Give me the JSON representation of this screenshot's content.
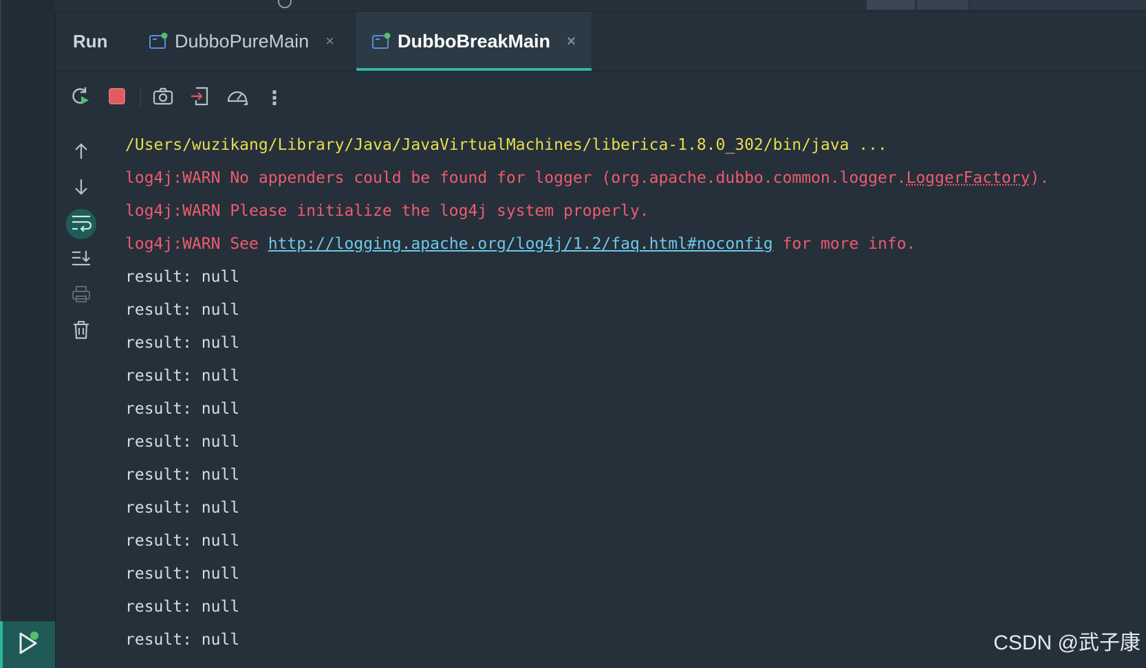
{
  "tool_window": {
    "title": "Run",
    "tabs": [
      {
        "label": "DubboPureMain",
        "active": false
      },
      {
        "label": "DubboBreakMain",
        "active": true
      }
    ],
    "close_glyph": "×"
  },
  "toolbar": {
    "icons": [
      "rerun-icon",
      "stop-icon",
      "screenshot-icon",
      "restore-layout-icon",
      "profiler-icon",
      "more-actions-icon"
    ],
    "more_glyph": "⋮"
  },
  "gutter": {
    "icons": [
      "up-arrow-icon",
      "down-arrow-icon",
      "soft-wrap-icon",
      "scroll-to-end-icon",
      "print-icon",
      "clear-icon"
    ],
    "active": "soft-wrap-icon"
  },
  "console": {
    "cmd_line": "/Users/wuzikang/Library/Java/JavaVirtualMachines/liberica-1.8.0_302/bin/java ...",
    "warn1_prefix": "log4j:WARN No appenders could be found for logger (org.apache.dubbo.common.logger.",
    "warn1_class": "LoggerFactory",
    "warn1_suffix": ").",
    "warn2": "log4j:WARN Please initialize the log4j system properly.",
    "warn3_prefix": "log4j:WARN See ",
    "warn3_link": "http://logging.apache.org/log4j/1.2/faq.html#noconfig",
    "warn3_suffix": " for more info.",
    "output_lines": [
      "result: null",
      "result: null",
      "result: null",
      "result: null",
      "result: null",
      "result: null",
      "result: null",
      "result: null",
      "result: null",
      "result: null",
      "result: null",
      "result: null"
    ]
  },
  "colors": {
    "background": "#25303a",
    "accent": "#2fb59f",
    "cmd": "#e9dd4f",
    "warn": "#ee5b6e",
    "link": "#6fc8ea",
    "output": "#d6dde3"
  },
  "watermark": "CSDN @武子康"
}
